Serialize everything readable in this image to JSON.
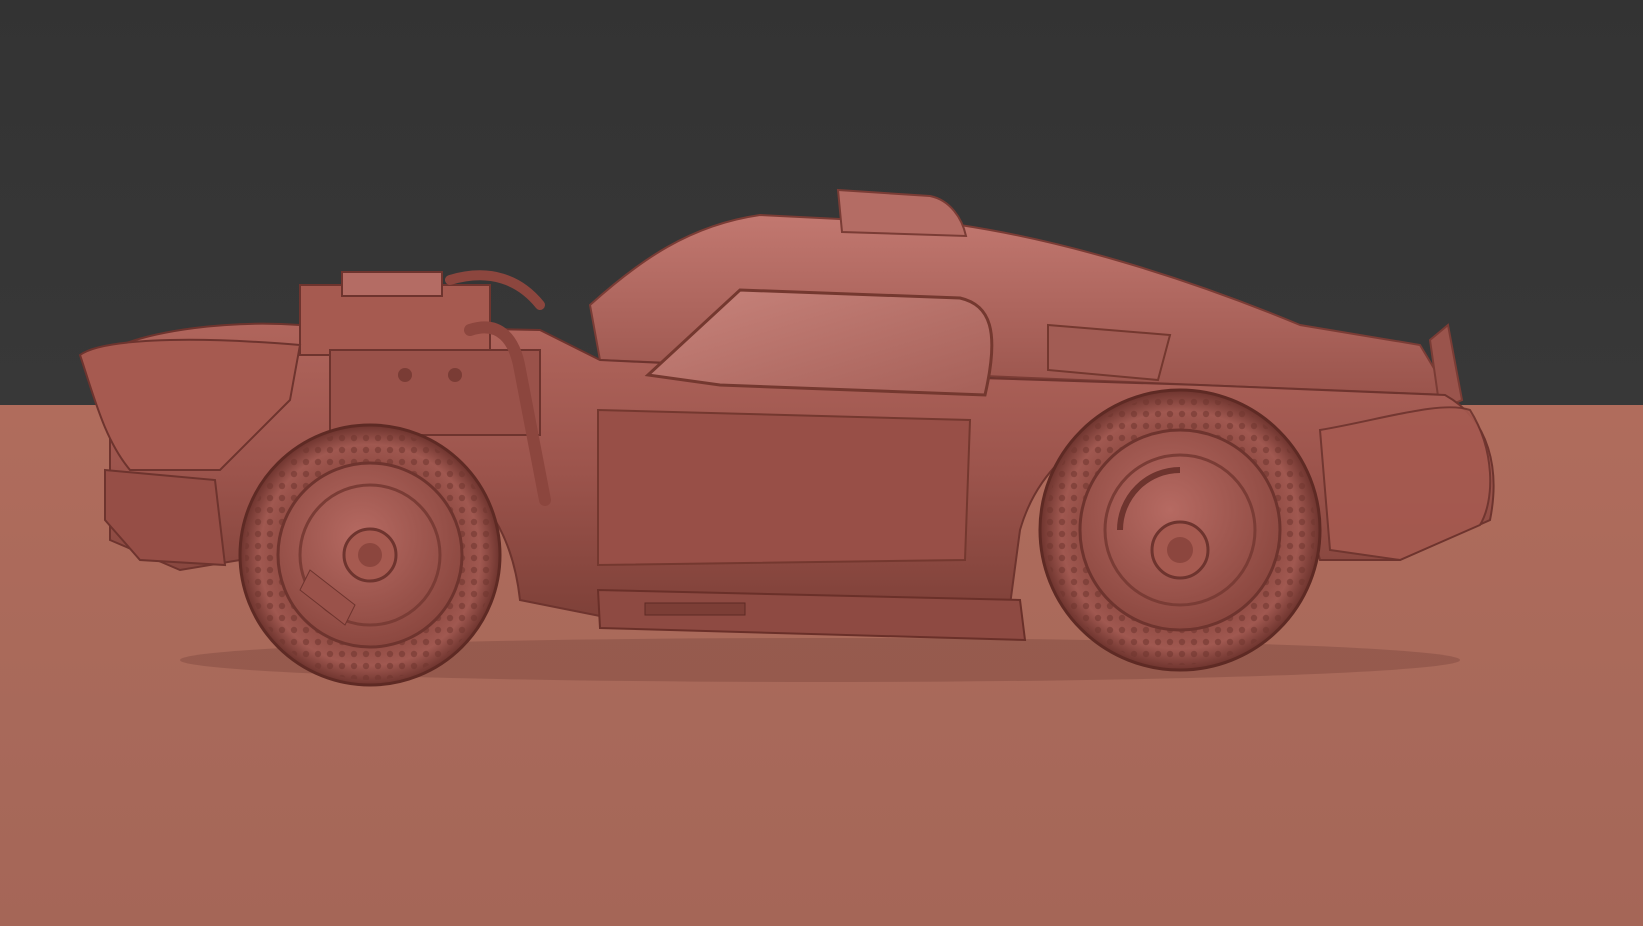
{
  "viewport": {
    "background_color": "#353535",
    "ground_color": "#a8695a",
    "model_color": "#a65a50"
  },
  "model": {
    "subject": "car-sculpt",
    "icons": [
      "car-icon",
      "wheel-icon",
      "engine-icon"
    ]
  }
}
